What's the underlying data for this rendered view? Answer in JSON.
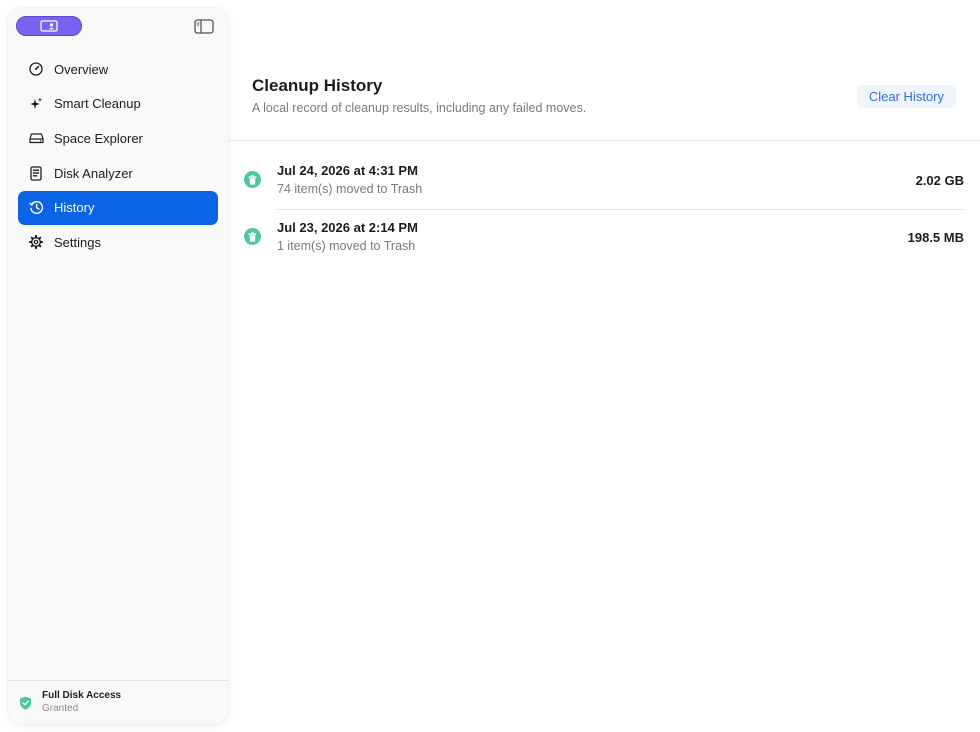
{
  "sidebar": {
    "nav": [
      {
        "label": "Overview",
        "icon": "gauge-icon"
      },
      {
        "label": "Smart Cleanup",
        "icon": "sparkles-icon"
      },
      {
        "label": "Space Explorer",
        "icon": "drive-icon"
      },
      {
        "label": "Disk Analyzer",
        "icon": "document-icon"
      },
      {
        "label": "History",
        "icon": "clock-history-icon",
        "active": true
      },
      {
        "label": "Settings",
        "icon": "gear-icon"
      }
    ],
    "footer": {
      "title": "Full Disk Access",
      "status": "Granted"
    }
  },
  "main": {
    "title": "Cleanup History",
    "subtitle": "A local record of cleanup results, including any failed moves.",
    "clear_label": "Clear History",
    "entries": [
      {
        "date": "Jul 24, 2026 at 4:31 PM",
        "desc": "74 item(s) moved to Trash",
        "size": "2.02 GB"
      },
      {
        "date": "Jul 23, 2026 at 2:14 PM",
        "desc": "1 item(s) moved to Trash",
        "size": "198.5 MB"
      }
    ]
  },
  "colors": {
    "accent": "#0b63e5",
    "account_button": "#7b61f0",
    "success": "#4ec89a",
    "link": "#2f6fd6"
  }
}
